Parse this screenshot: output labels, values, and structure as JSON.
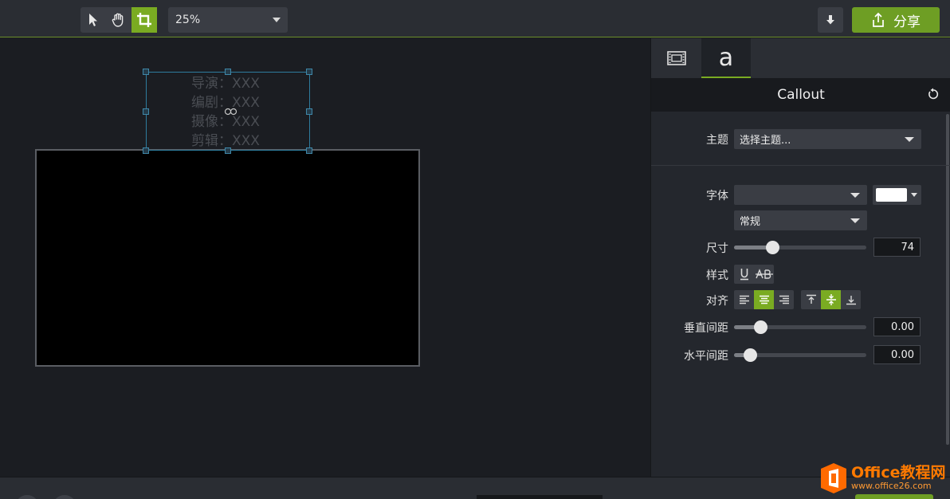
{
  "toolbar": {
    "zoom_value": "25%",
    "share_label": "分享"
  },
  "canvas": {
    "callout_lines": [
      "导演：XXX",
      "编剧：XXX",
      "摄像：XXX",
      "剪辑：XXX"
    ]
  },
  "panel": {
    "text_tab_label": "a",
    "title": "Callout",
    "theme_label": "主题",
    "theme_value": "选择主题...",
    "font_label": "字体",
    "font_value": "",
    "font_style_value": "常规",
    "font_color": "#ffffff",
    "size_label": "尺寸",
    "size_value": "74",
    "size_slider_fraction": 0.27,
    "style_label": "样式",
    "align_label": "对齐",
    "horizontal_alignment": "center",
    "vertical_alignment": "middle",
    "line_spacing_label": "垂直间距",
    "line_spacing_value": "0.00",
    "line_spacing_fraction": 0.17,
    "char_spacing_label": "水平间距",
    "char_spacing_value": "0.00",
    "char_spacing_fraction": 0.08
  },
  "watermark": {
    "title": "Office教程网",
    "url": "www.office26.com"
  },
  "colors": {
    "accent": "#7aab22",
    "background": "#1b1d22",
    "panel": "#24272d"
  }
}
